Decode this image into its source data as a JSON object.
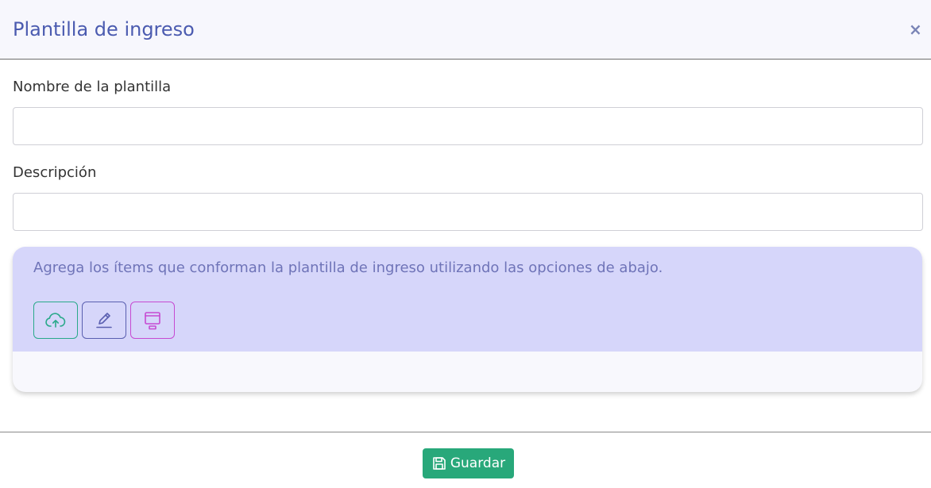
{
  "header": {
    "title": "Plantilla de ingreso",
    "close_icon": "close-icon",
    "close_glyph": "×"
  },
  "form": {
    "name_label": "Nombre de la plantilla",
    "name_value": "",
    "name_placeholder": "",
    "description_label": "Descripción",
    "description_value": "",
    "description_placeholder": ""
  },
  "items_panel": {
    "hint": "Agrega los ítems que conforman la plantilla de ingreso utilizando las opciones de abajo.",
    "tools": [
      {
        "icon": "cloud-upload-icon",
        "color": "#2aa98a"
      },
      {
        "icon": "pen-icon",
        "color": "#5a5fb0"
      },
      {
        "icon": "layout-icon",
        "color": "#c64ad2"
      }
    ]
  },
  "footer": {
    "save_label": "Guardar",
    "save_icon": "floppy-disk-icon",
    "save_color": "#28a87a"
  },
  "colors": {
    "accent": "#4b5bb0",
    "panel_bg": "#d6d6fa"
  }
}
